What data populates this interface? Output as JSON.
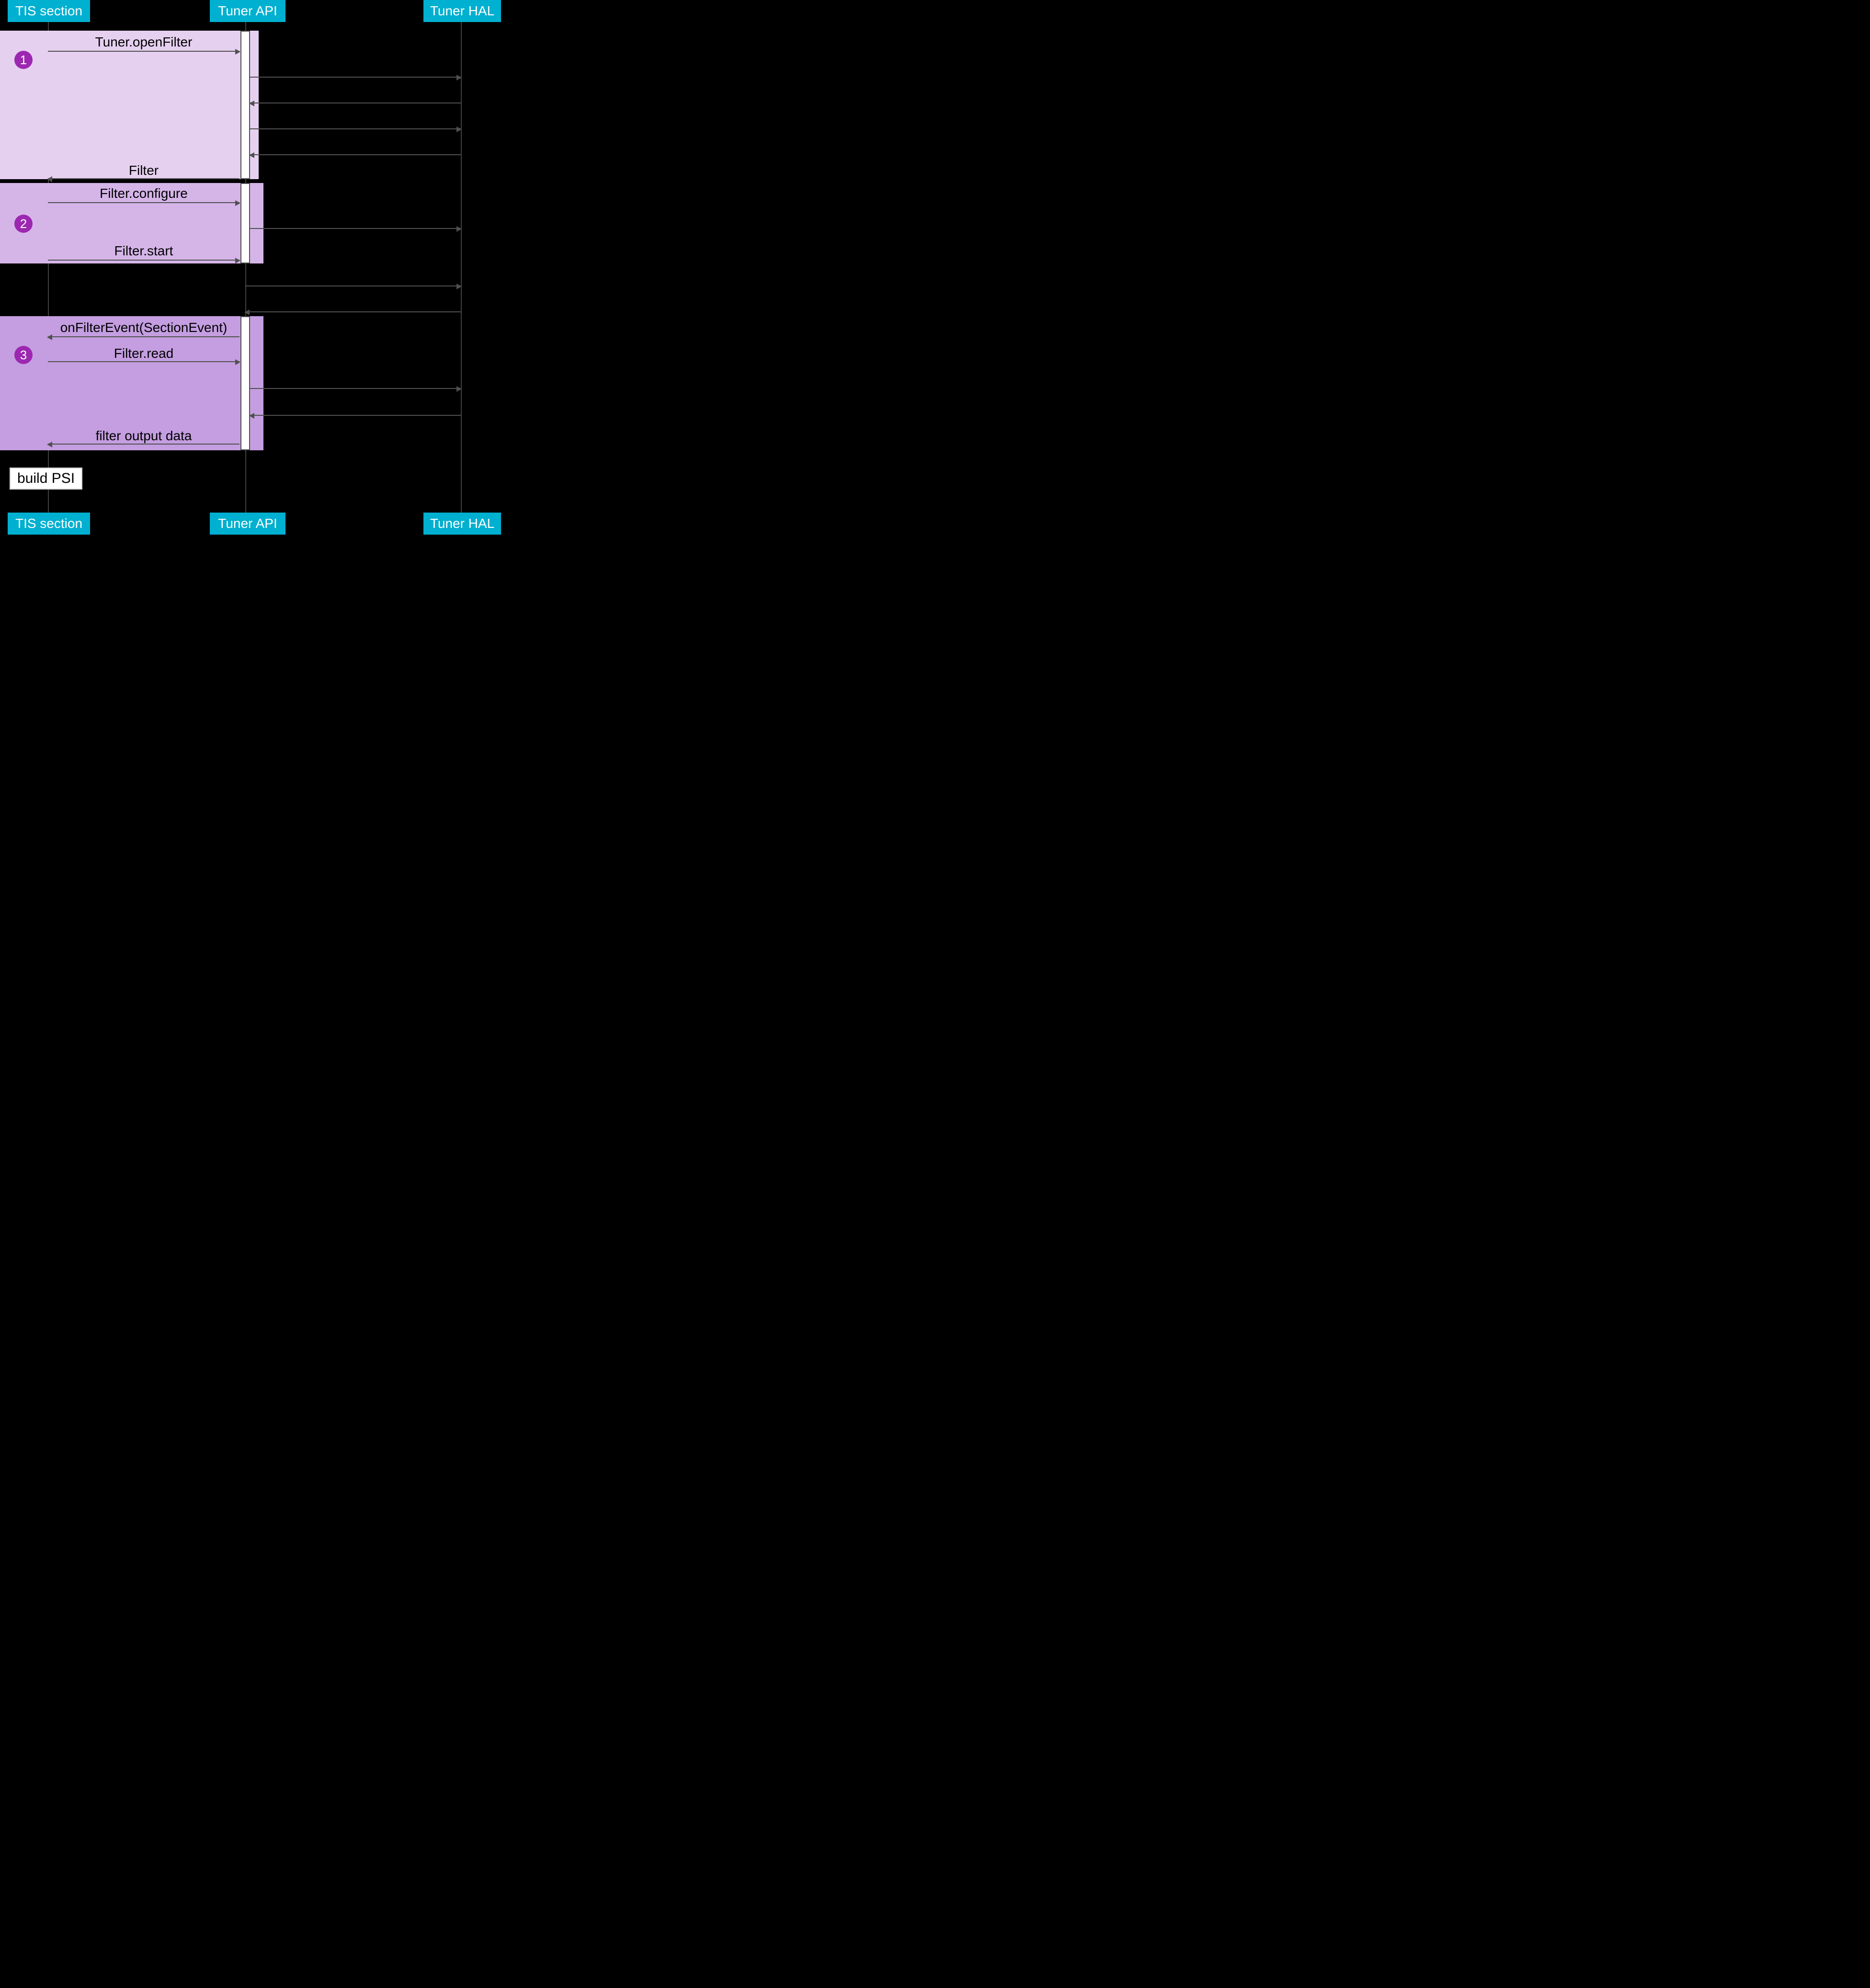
{
  "participants": {
    "left": "TIS section",
    "mid": "Tuner API",
    "right": "Tuner HAL"
  },
  "badges": {
    "b1": "1",
    "b2": "2",
    "b3": "3"
  },
  "messages": {
    "m1": "Tuner.openFilter",
    "m2": "Filter",
    "m3": "Filter.configure",
    "m4": "Filter.start",
    "m5": "onFilterEvent(SectionEvent)",
    "m6": "Filter.read",
    "m7": "filter output data"
  },
  "note": "build PSI"
}
